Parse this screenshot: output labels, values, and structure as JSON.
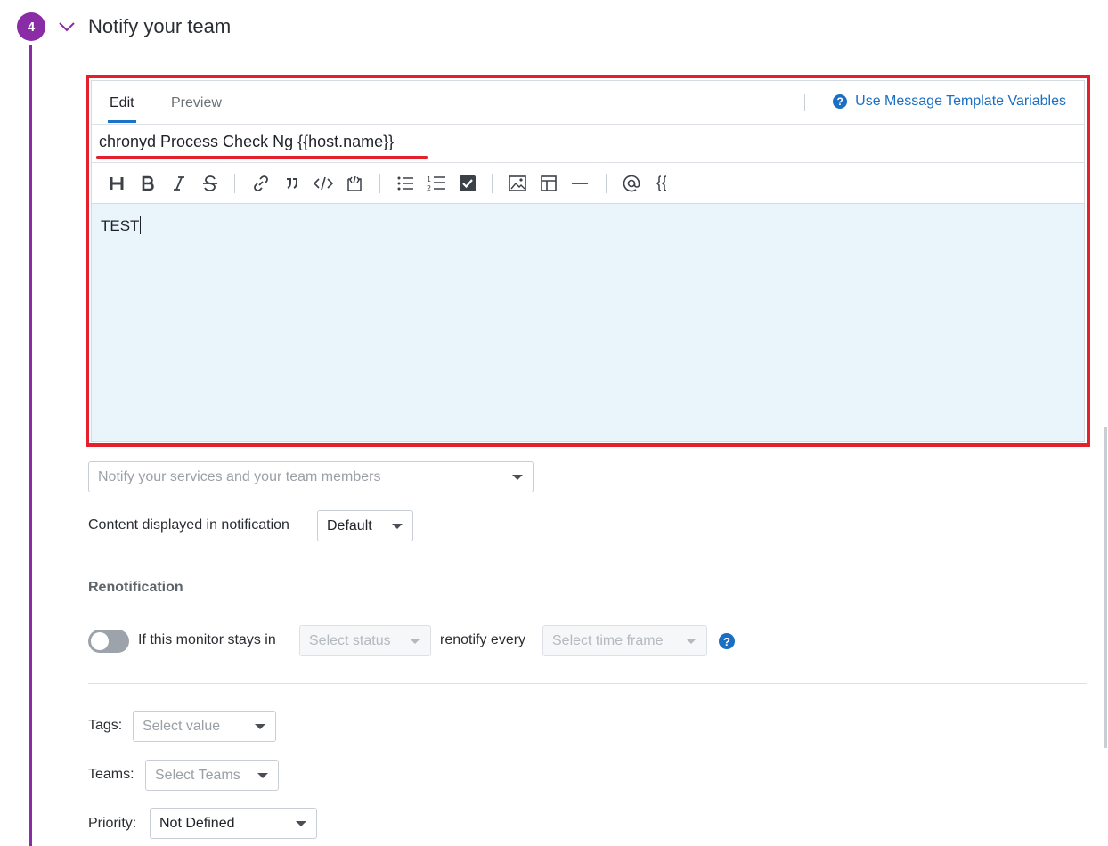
{
  "section": {
    "step_number": "4",
    "title": "Notify your team"
  },
  "editor": {
    "tabs": [
      {
        "label": "Edit",
        "active": true
      },
      {
        "label": "Preview",
        "active": false
      }
    ],
    "help_link": "Use Message Template Variables",
    "help_icon": "?",
    "title_value": "chronyd Process Check Ng {{host.name}}",
    "toolbar": [
      "heading-icon",
      "bold-icon",
      "italic-icon",
      "strikethrough-icon",
      "link-icon",
      "quote-icon",
      "code-icon",
      "code-block-icon",
      "bullet-list-icon",
      "numbered-list-icon",
      "checkbox-list-icon",
      "image-icon",
      "table-icon",
      "horizontal-rule-icon",
      "mention-icon",
      "template-variable-icon"
    ],
    "body_text": "TEST"
  },
  "notify": {
    "placeholder": "Notify your services and your team members"
  },
  "content_displayed": {
    "label": "Content displayed in notification",
    "value": "Default"
  },
  "renotification": {
    "heading": "Renotification",
    "toggle_on": false,
    "prefix": "If this monitor stays in",
    "status_placeholder": "Select status",
    "middle": "renotify every",
    "timeframe_placeholder": "Select time frame",
    "help_icon": "?"
  },
  "tags": {
    "label": "Tags:",
    "placeholder": "Select value"
  },
  "teams": {
    "label": "Teams:",
    "placeholder": "Select Teams"
  },
  "priority": {
    "label": "Priority:",
    "value": "Not Defined"
  },
  "colors": {
    "accent": "#8b2ca7",
    "link": "#1a6fc4",
    "highlight": "#e3202b",
    "editor_bg": "#eaf4fb"
  }
}
